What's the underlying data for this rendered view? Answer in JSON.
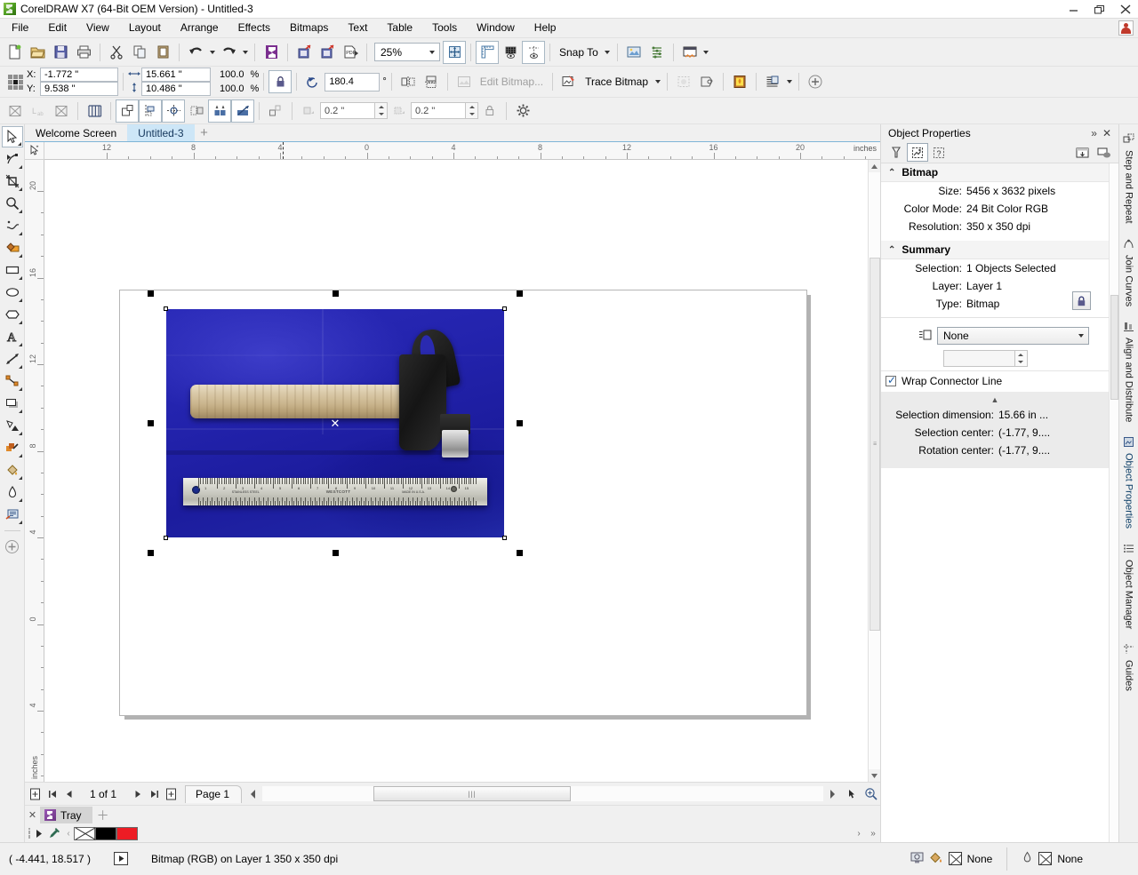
{
  "window": {
    "title": "CorelDRAW X7 (64-Bit OEM Version) - Untitled-3",
    "minimize": "–",
    "restore": "❐",
    "close": "✕"
  },
  "menubar": {
    "items": [
      {
        "label": "File"
      },
      {
        "label": "Edit"
      },
      {
        "label": "View"
      },
      {
        "label": "Layout"
      },
      {
        "label": "Arrange"
      },
      {
        "label": "Effects"
      },
      {
        "label": "Bitmaps"
      },
      {
        "label": "Text"
      },
      {
        "label": "Table"
      },
      {
        "label": "Tools"
      },
      {
        "label": "Window"
      },
      {
        "label": "Help"
      }
    ]
  },
  "toolbar": {
    "zoom_level": "25%",
    "snap_to_label": "Snap To",
    "icons": [
      "new-document-icon",
      "open-folder-icon",
      "save-icon",
      "print-icon",
      "cut-icon",
      "copy-icon",
      "paste-icon",
      "undo-icon",
      "redo-icon",
      "corel-connect-icon",
      "import-icon",
      "export-icon",
      "publish-pdf-icon",
      "full-screen-preview-icon",
      "show-rulers-icon",
      "show-grid-icon",
      "show-guides-icon",
      "options-icon",
      "launch-apps-icon",
      "window-layout-icon"
    ]
  },
  "propertybar": {
    "x_label": "X:",
    "x_value": "-1.772 \"",
    "y_label": "Y:",
    "y_value": "9.538 \"",
    "width_value": "15.661 \"",
    "height_value": "10.486 \"",
    "scale_x": "100.0",
    "scale_y": "100.0",
    "percent": "%",
    "rotation_value": "180.4",
    "rotation_unit": "°",
    "edit_bitmap_label": "Edit Bitmap...",
    "trace_bitmap_label": "Trace Bitmap",
    "nudge_value_1": "0.2 \"",
    "nudge_value_2": "0.2 \""
  },
  "toolbox": {
    "tools": [
      {
        "name": "pick-tool",
        "active": true
      },
      {
        "name": "shape-tool",
        "active": false
      },
      {
        "name": "crop-tool",
        "active": false
      },
      {
        "name": "zoom-tool",
        "active": false
      },
      {
        "name": "freehand-tool",
        "active": false
      },
      {
        "name": "smart-fill-tool",
        "active": false
      },
      {
        "name": "rectangle-tool",
        "active": false
      },
      {
        "name": "ellipse-tool",
        "active": false
      },
      {
        "name": "polygon-tool",
        "active": false
      },
      {
        "name": "text-tool",
        "active": false
      },
      {
        "name": "dimension-tool",
        "active": false
      },
      {
        "name": "connector-tool",
        "active": false
      },
      {
        "name": "drop-shadow-tool",
        "active": false
      },
      {
        "name": "transparency-tool",
        "active": false
      },
      {
        "name": "color-eyedropper-tool",
        "active": false
      },
      {
        "name": "fill-tool",
        "active": false
      },
      {
        "name": "outline-tool",
        "active": false
      },
      {
        "name": "interactive-fill-tool",
        "active": false
      },
      {
        "name": "add-tool-icon",
        "active": false
      }
    ]
  },
  "tabs": {
    "items": [
      {
        "label": "Welcome Screen",
        "active": false
      },
      {
        "label": "Untitled-3",
        "active": true
      }
    ],
    "add_label": "+"
  },
  "rulers": {
    "unit": "inches",
    "horizontal_ticks": [
      "12",
      "8",
      "4",
      "0",
      "4",
      "8",
      "12",
      "16",
      "20"
    ],
    "vertical_ticks": [
      "20",
      "16",
      "12",
      "8",
      "4",
      "0",
      "4"
    ]
  },
  "canvas": {
    "object_center_marker": "✕",
    "photo": {
      "description": "claw hammer with wooden handle and steel ruler on blue cloth",
      "ruler_brand": "WESTCOTT",
      "ruler_sub_left": "STAINLESS STEEL",
      "ruler_sub_right": "MADE IN U.S.A.",
      "ruler_numbers": [
        "1",
        "2",
        "3",
        "4",
        "5",
        "6",
        "7",
        "8",
        "9",
        "10",
        "11",
        "12",
        "13",
        "14",
        "15"
      ],
      "cloth_color": "#2323ad",
      "wood_color": "#d9c8a6"
    }
  },
  "navigation": {
    "page_count_label": "1 of 1",
    "page_tab_label": "Page 1"
  },
  "tray": {
    "label": "Tray",
    "close": "✕",
    "add": "＋"
  },
  "palette": {
    "swatches": [
      {
        "name": "no-color-swatch",
        "color": "none"
      },
      {
        "name": "black-swatch",
        "color": "#000000"
      },
      {
        "name": "red-swatch",
        "color": "#ed1c24"
      }
    ]
  },
  "docker": {
    "title": "Object Properties",
    "collapse": "»",
    "close": "✕",
    "toolbar_icons": [
      {
        "name": "fill-properties-icon",
        "selected": false
      },
      {
        "name": "bitmap-properties-icon",
        "selected": true
      },
      {
        "name": "summary-properties-icon",
        "selected": false
      },
      {
        "name": "import-style-icon",
        "selected": false
      },
      {
        "name": "apply-style-icon",
        "selected": false
      }
    ],
    "bitmap_section": {
      "title": "Bitmap",
      "rows": [
        {
          "key": "Size:",
          "value": "5456 x 3632 pixels"
        },
        {
          "key": "Color Mode:",
          "value": "24 Bit Color  RGB"
        },
        {
          "key": "Resolution:",
          "value": "350 x 350 dpi"
        }
      ]
    },
    "summary_section": {
      "title": "Summary",
      "rows": [
        {
          "key": "Selection:",
          "value": "1 Objects Selected"
        },
        {
          "key": "Layer:",
          "value": "Layer 1"
        },
        {
          "key": "Type:",
          "value": "Bitmap"
        }
      ]
    },
    "style_dropdown_value": "None",
    "wrap_checkbox_label": "Wrap Connector Line",
    "wrap_checked": true,
    "collapse_arrow": "▲",
    "info_rows": [
      {
        "key": "Selection dimension:",
        "value": "15.66 in ..."
      },
      {
        "key": "Selection center:",
        "value": "(-1.77, 9...."
      },
      {
        "key": "Rotation center:",
        "value": "(-1.77, 9...."
      }
    ]
  },
  "side_tabs": [
    {
      "label": "Step and Repeat",
      "icon": "step-repeat-icon",
      "active": false
    },
    {
      "label": "Join Curves",
      "icon": "join-curves-icon",
      "active": false
    },
    {
      "label": "Align and Distribute",
      "icon": "align-distribute-icon",
      "active": false
    },
    {
      "label": "Object Properties",
      "icon": "object-properties-icon",
      "active": true
    },
    {
      "label": "Object Manager",
      "icon": "object-manager-icon",
      "active": false
    },
    {
      "label": "Guides",
      "icon": "guides-icon",
      "active": false
    }
  ],
  "statusbar": {
    "coordinates": "( -4.441, 18.517 )",
    "object_info": "Bitmap (RGB) on Layer 1 350 x 350 dpi",
    "fill_label": "None",
    "outline_label": "None"
  }
}
